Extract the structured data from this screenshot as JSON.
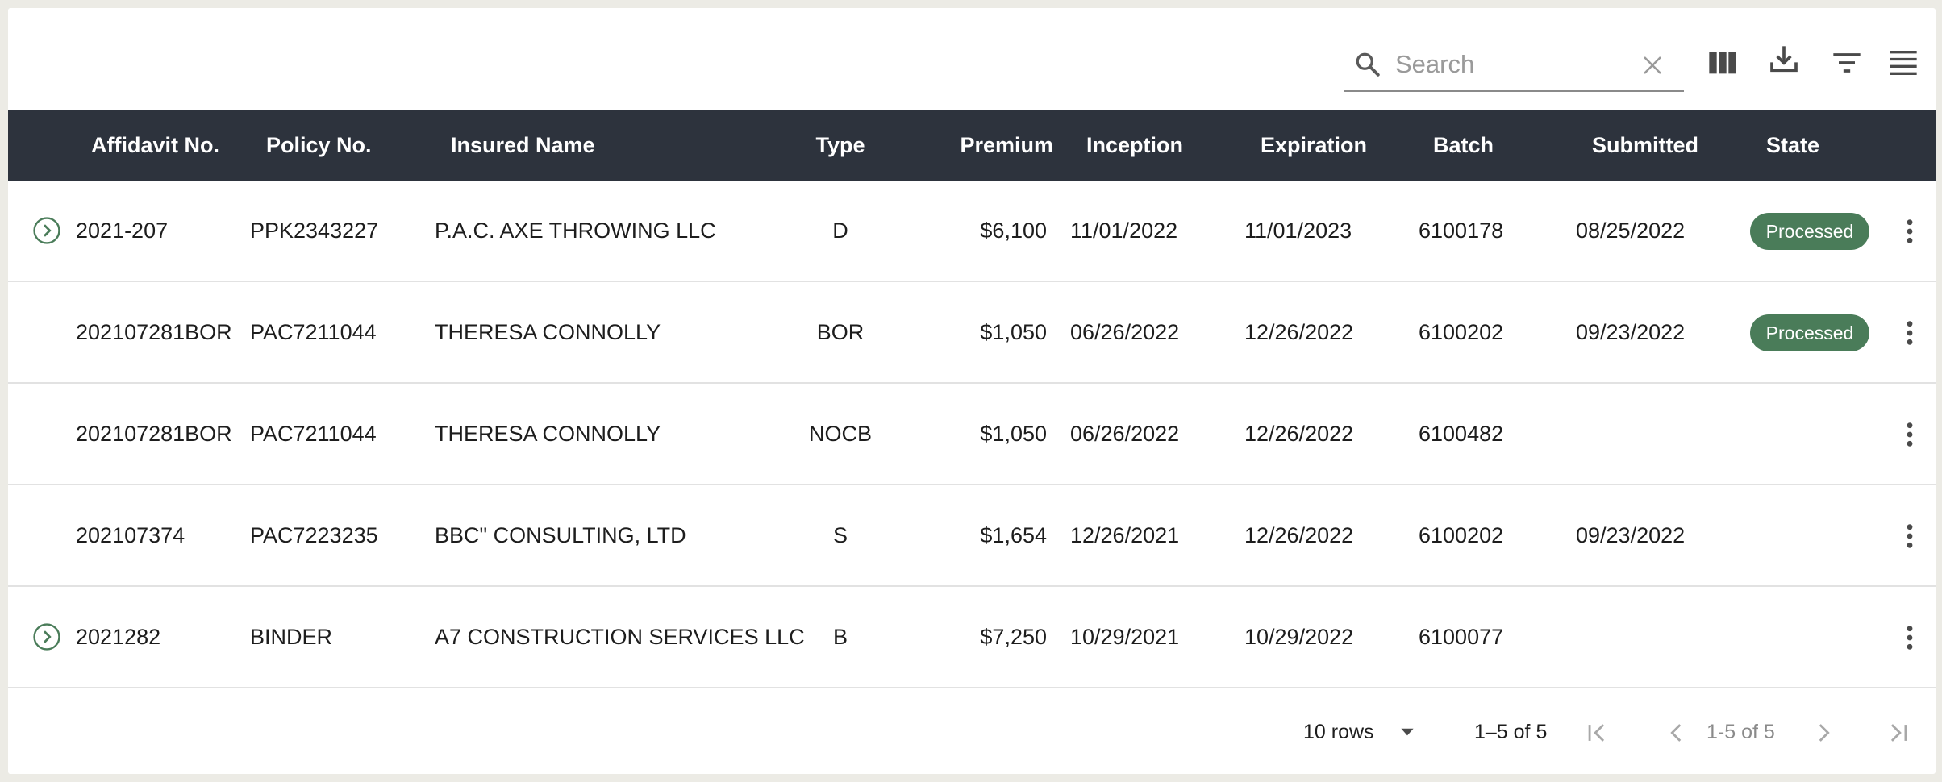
{
  "search": {
    "placeholder": "Search",
    "value": ""
  },
  "toolbar": {
    "icons": [
      "search-icon",
      "close-icon",
      "view-column-icon",
      "download-icon",
      "filter-icon",
      "density-icon"
    ]
  },
  "columns": [
    "Affidavit No.",
    "Policy No.",
    "Insured Name",
    "Type",
    "Premium",
    "Inception",
    "Expiration",
    "Batch",
    "Submitted",
    "State"
  ],
  "rows": [
    {
      "affidavit": "2021-207",
      "policy": "PPK2343227",
      "insured": "P.A.C. AXE THROWING LLC",
      "type": "D",
      "premium": "$6,100",
      "inception": "11/01/2022",
      "expiration": "11/01/2023",
      "batch": "6100178",
      "submitted": "08/25/2022",
      "state": "Processed",
      "expandable": true
    },
    {
      "affidavit": "202107281BOR",
      "policy": "PAC7211044",
      "insured": "THERESA CONNOLLY",
      "type": "BOR",
      "premium": "$1,050",
      "inception": "06/26/2022",
      "expiration": "12/26/2022",
      "batch": "6100202",
      "submitted": "09/23/2022",
      "state": "Processed",
      "expandable": false
    },
    {
      "affidavit": "202107281BOR",
      "policy": "PAC7211044",
      "insured": "THERESA CONNOLLY",
      "type": "NOCB",
      "premium": "$1,050",
      "inception": "06/26/2022",
      "expiration": "12/26/2022",
      "batch": "6100482",
      "submitted": "",
      "state": "",
      "expandable": false
    },
    {
      "affidavit": "202107374",
      "policy": "PAC7223235",
      "insured": "BBC\" CONSULTING, LTD",
      "type": "S",
      "premium": "$1,654",
      "inception": "12/26/2021",
      "expiration": "12/26/2022",
      "batch": "6100202",
      "submitted": "09/23/2022",
      "state": "",
      "expandable": false
    },
    {
      "affidavit": "2021282",
      "policy": "BINDER",
      "insured": "A7 CONSTRUCTION SERVICES LLC",
      "type": "B",
      "premium": "$7,250",
      "inception": "10/29/2021",
      "expiration": "10/29/2022",
      "batch": "6100077",
      "submitted": "",
      "state": "",
      "expandable": true
    }
  ],
  "colors": {
    "header_bg": "#2d333d",
    "badge_bg": "#4a7c59",
    "accent": "#4a7c59"
  },
  "footer": {
    "rows_per_page": "10 rows",
    "range": "1–5 of 5",
    "page_label": "1-5 of 5"
  }
}
